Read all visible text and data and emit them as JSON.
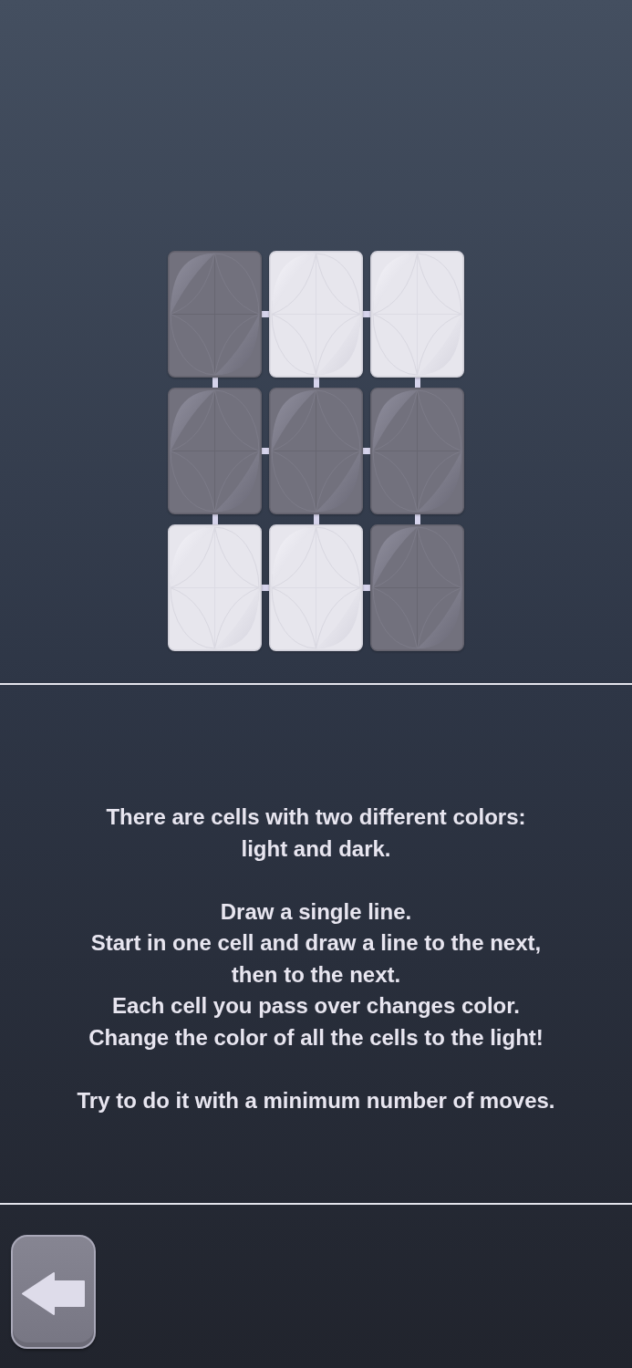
{
  "board": {
    "rows": [
      {
        "cells": [
          {
            "lit": false
          },
          {
            "lit": true
          },
          {
            "lit": true
          }
        ]
      },
      {
        "cells": [
          {
            "lit": false
          },
          {
            "lit": false
          },
          {
            "lit": false
          }
        ]
      },
      {
        "cells": [
          {
            "lit": true
          },
          {
            "lit": true
          },
          {
            "lit": false
          }
        ]
      }
    ]
  },
  "instructions": [
    {
      "lines": [
        "There are cells with two different colors:",
        "light and dark."
      ]
    },
    {
      "lines": [
        "Draw a single line.",
        "Start in one cell and draw a line to the next,",
        "then to the next.",
        "Each cell you pass over changes color.",
        "Change the color of all the cells to the light!"
      ]
    },
    {
      "lines": [
        "Try to do it with a minimum number of moves."
      ]
    }
  ]
}
